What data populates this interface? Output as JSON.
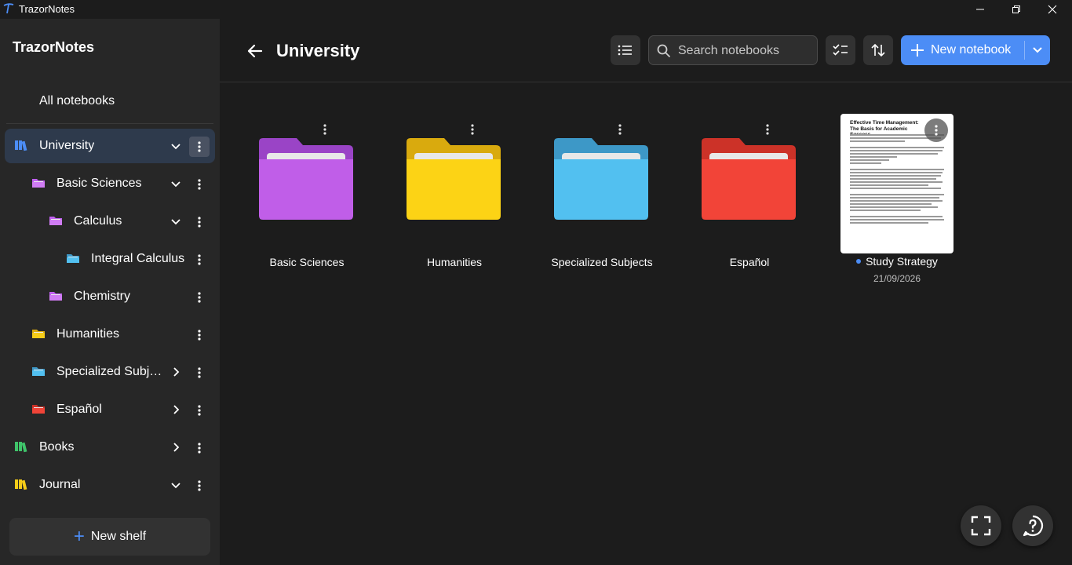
{
  "window": {
    "title": "TrazorNotes"
  },
  "sidebar": {
    "brand": "TrazorNotes",
    "all_notebooks": "All notebooks",
    "items": [
      {
        "label": "University",
        "icon": "shelf-icon",
        "color": "#4c8df6",
        "expanded": true,
        "active": true
      },
      {
        "label": "Basic Sciences",
        "icon": "folder-icon",
        "color": "#c060f0",
        "expanded": true
      },
      {
        "label": "Calculus",
        "icon": "folder-icon",
        "color": "#c060f0",
        "expanded": true
      },
      {
        "label": "Integral Calculus",
        "icon": "folder-icon",
        "color": "#52c0f0"
      },
      {
        "label": "Chemistry",
        "icon": "folder-icon",
        "color": "#c060f0"
      },
      {
        "label": "Humanities",
        "icon": "folder-icon",
        "color": "#f5cc18"
      },
      {
        "label": "Specialized Subje...",
        "icon": "folder-icon",
        "color": "#52c0f0",
        "expanded": false
      },
      {
        "label": "Español",
        "icon": "folder-icon",
        "color": "#f04438",
        "expanded": false
      },
      {
        "label": "Books",
        "icon": "shelf-icon",
        "color": "#3fc46a",
        "expanded": false
      },
      {
        "label": "Journal",
        "icon": "shelf-icon",
        "color": "#f5cc18",
        "expanded": true
      }
    ],
    "new_shelf": "New shelf"
  },
  "header": {
    "title": "University",
    "search_placeholder": "Search notebooks",
    "new_notebook": "New notebook"
  },
  "grid": {
    "folders": [
      {
        "label": "Basic Sciences",
        "color": "#c05ee8",
        "tab": "#9a44c6"
      },
      {
        "label": "Humanities",
        "color": "#fcd315",
        "tab": "#d9aa0e"
      },
      {
        "label": "Specialized Subjects",
        "color": "#52c0f0",
        "tab": "#3d98c7"
      },
      {
        "label": "Español",
        "color": "#f24438",
        "tab": "#cc3228"
      }
    ],
    "notebook": {
      "title": "Study Strategy",
      "date": "21/09/2026",
      "preview_heading": "Effective Time Management: The Basis for Academic Success"
    }
  }
}
